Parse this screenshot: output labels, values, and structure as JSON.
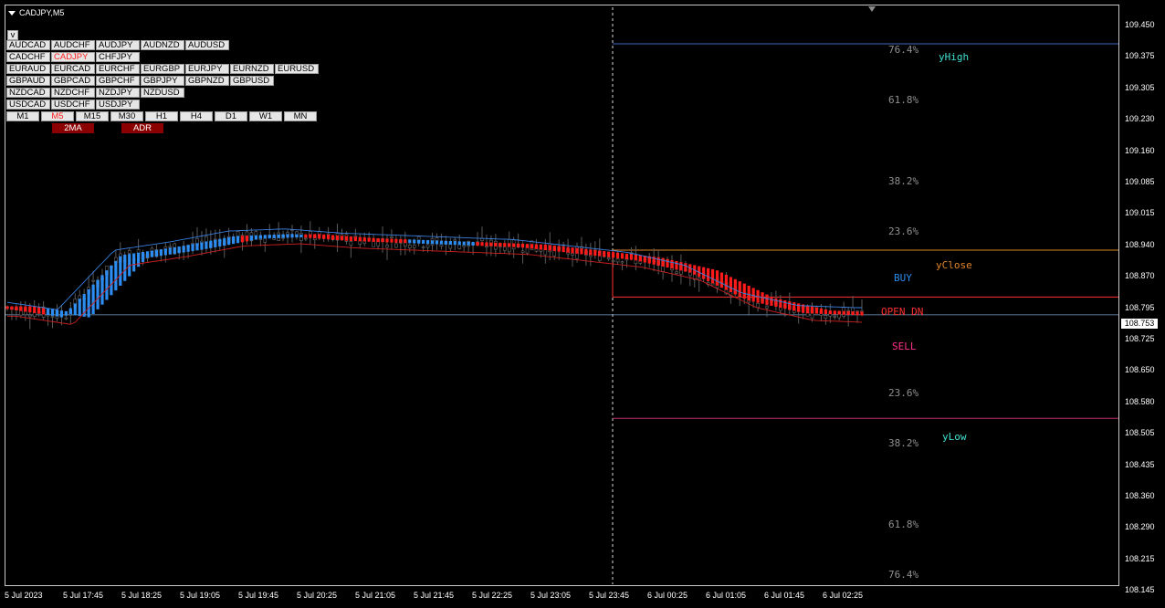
{
  "window": {
    "title": "CADJPY,M5"
  },
  "symbol_toggle": "v",
  "symbols": [
    [
      "AUDCAD",
      "AUDCHF",
      "AUDJPY",
      "AUDNZD",
      "AUDUSD"
    ],
    [
      "CADCHF",
      "CADJPY",
      "CHFJPY"
    ],
    [
      "EURAUD",
      "EURCAD",
      "EURCHF",
      "EURGBP",
      "EURJPY",
      "EURNZD",
      "EURUSD"
    ],
    [
      "GBPAUD",
      "GBPCAD",
      "GBPCHF",
      "GBPJPY",
      "GBPNZD",
      "GBPUSD"
    ],
    [
      "NZDCAD",
      "NZDCHF",
      "NZDJPY",
      "NZDUSD"
    ],
    [
      "USDCAD",
      "USDCHF",
      "USDJPY"
    ]
  ],
  "selected_symbol": "CADJPY",
  "timeframes": [
    "M1",
    "M5",
    "M15",
    "M30",
    "H1",
    "H4",
    "D1",
    "W1",
    "MN"
  ],
  "selected_timeframe": "M5",
  "indicator_buttons": [
    "2MA",
    "ADR"
  ],
  "price_axis": {
    "labels": [
      "109.450",
      "109.375",
      "109.305",
      "109.230",
      "109.160",
      "109.085",
      "109.015",
      "108.940",
      "108.870",
      "108.795",
      "108.725",
      "108.650",
      "108.580",
      "108.505",
      "108.435",
      "108.360",
      "108.290",
      "108.215",
      "108.145"
    ],
    "current_price": "108.753"
  },
  "time_axis": {
    "labels": [
      "5 Jul 2023",
      "5 Jul 17:45",
      "5 Jul 18:25",
      "5 Jul 19:05",
      "5 Jul 19:45",
      "5 Jul 20:25",
      "5 Jul 21:05",
      "5 Jul 21:45",
      "5 Jul 22:25",
      "5 Jul 23:05",
      "5 Jul 23:45",
      "6 Jul 00:25",
      "6 Jul 01:05",
      "6 Jul 01:45",
      "6 Jul 02:25"
    ]
  },
  "fib_labels": {
    "upper": [
      "76.4%",
      "61.8%",
      "38.2%",
      "23.6%"
    ],
    "lower": [
      "23.6%",
      "38.2%",
      "61.8%",
      "76.4%"
    ]
  },
  "levels": {
    "yhigh": "yHigh",
    "yclose": "yClose",
    "buy": "BUY",
    "open_dn": "OPEN DN",
    "sell": "SELL",
    "ylow": "yLow"
  },
  "colors": {
    "background": "#000000",
    "uptrend": "#2d8cf0",
    "downtrend": "#ff1a1a",
    "yhigh_line": "#3a6fbf",
    "yclose_line": "#e0862a",
    "open_line": "#ff3030",
    "ylow_line": "#c03070"
  },
  "chart_data": {
    "type": "line",
    "title": "CADJPY,M5",
    "ylim": [
      108.12,
      109.48
    ],
    "x": [
      "5 Jul 17:05",
      "5 Jul 17:45",
      "5 Jul 18:25",
      "5 Jul 19:05",
      "5 Jul 19:45",
      "5 Jul 20:25",
      "5 Jul 21:05",
      "5 Jul 21:45",
      "5 Jul 22:25",
      "5 Jul 23:05",
      "5 Jul 23:45",
      "6 Jul 00:25",
      "6 Jul 01:05",
      "6 Jul 01:45",
      "6 Jul 02:25",
      "6 Jul 02:45"
    ],
    "series": [
      {
        "values": [
          108.77,
          108.75,
          108.89,
          108.91,
          108.935,
          108.94,
          108.93,
          108.925,
          108.92,
          108.915,
          108.9,
          108.885,
          108.855,
          108.79,
          108.76,
          108.755
        ]
      }
    ],
    "current_price": 108.753,
    "levels": {
      "yHigh": 109.39,
      "yClose": 108.905,
      "open": 108.795,
      "yLow": 108.51
    }
  }
}
